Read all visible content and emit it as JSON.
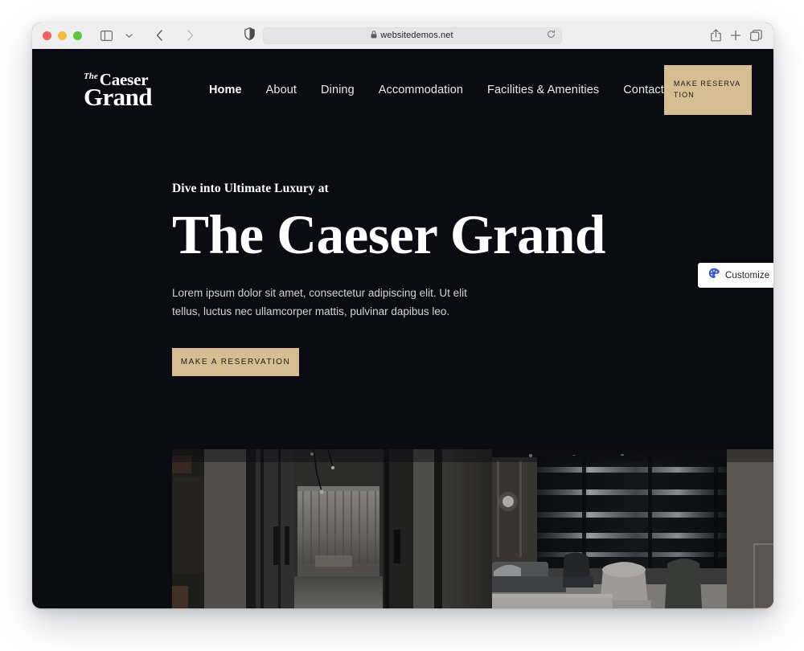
{
  "browser": {
    "window_controls": [
      "close",
      "minimize",
      "maximize"
    ],
    "sidebar_icon": "sidebar-icon",
    "dropdown_icon": "chevron-down-icon",
    "back_icon": "chevron-left-icon",
    "forward_icon": "chevron-right-icon",
    "shield_icon": "privacy-shield-icon",
    "url": "websitedemos.net",
    "lock_icon": "lock-icon",
    "reload_icon": "reload-icon",
    "share_icon": "share-icon",
    "new_tab_icon": "plus-icon",
    "tabs_icon": "tab-overview-icon"
  },
  "site": {
    "logo": {
      "the": "The",
      "caeser": "Caeser",
      "grand": "Grand"
    },
    "nav": [
      {
        "label": "Home",
        "active": true
      },
      {
        "label": "About",
        "active": false
      },
      {
        "label": "Dining",
        "active": false
      },
      {
        "label": "Accommodation",
        "active": false
      },
      {
        "label": "Facilities & Amenities",
        "active": false
      },
      {
        "label": "Contact",
        "active": false
      }
    ],
    "header_cta": "MAKE RESERVATION",
    "hero": {
      "eyebrow": "Dive into Ultimate Luxury at",
      "title": "The Caeser Grand",
      "paragraph": "Lorem ipsum dolor sit amet, consectetur adipiscing elit. Ut elit tellus, luctus nec ullamcorper mattis, pulvinar dapibus leo.",
      "cta": "MAKE A RESERVATION",
      "image_alt": "dark-luxury-hotel-suite-interior"
    }
  },
  "customize_widget": {
    "label": "Customize",
    "icon": "palette-icon"
  },
  "colors": {
    "page_background": "#0a0c11",
    "accent_tan": "#d6be93",
    "toolbar": "#f0eff0",
    "customize_blue": "#3858d6",
    "text_light": "#d3d4d6"
  }
}
